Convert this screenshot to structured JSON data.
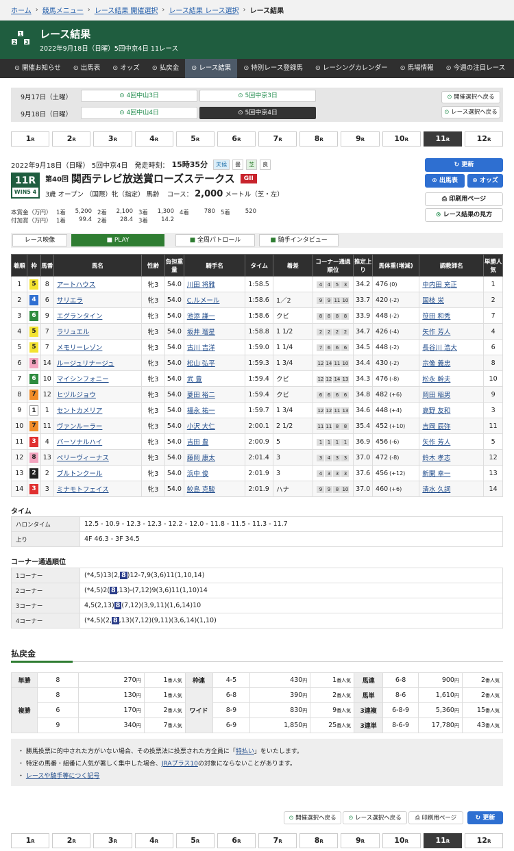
{
  "breadcrumb": {
    "home": "ホーム",
    "menu": "競馬メニュー",
    "kaisai": "レース結果 開催選択",
    "race": "レース結果 レース選択",
    "current": "レース結果"
  },
  "header": {
    "title": "レース結果",
    "subtitle": "2022年9月18日（日曜）5回中京4日 11レース",
    "logo": [
      "2",
      "1",
      "3"
    ]
  },
  "nav": [
    "開催お知らせ",
    "出馬表",
    "オッズ",
    "払戻金",
    "レース結果",
    "特別レース登録馬",
    "レーシングカレンダー",
    "馬場情報",
    "今週の注目レース"
  ],
  "dates": [
    {
      "label": "9月17日（土曜）",
      "m1": "4回中山3日",
      "m2": "5回中京3日"
    },
    {
      "label": "9月18日（日曜）",
      "m1": "4回中山4日",
      "m2": "5回中京4日"
    }
  ],
  "side_buttons": {
    "kaisai": "開催選択へ戻る",
    "race": "レース選択へ戻る"
  },
  "race_tabs": [
    "1",
    "2",
    "3",
    "4",
    "5",
    "6",
    "7",
    "8",
    "9",
    "10",
    "11",
    "12"
  ],
  "race_tab_suffix": "R",
  "cond": {
    "date": "2022年9月18日（日曜） 5回中京4日",
    "start_label": "発走時刻：",
    "start": "15時35分",
    "weather_k": "天候",
    "weather": "曇",
    "turf_k": "芝",
    "turf": "良"
  },
  "race": {
    "num": "11R",
    "win5": "WIN5 4",
    "ordinal": "第40回",
    "name": "関西テレビ放送賞ローズステークス",
    "grade": "GII",
    "conditions": "3歳 オープン （国際）牝（指定） 馬齢",
    "course_label": "コース：",
    "distance": "2,000",
    "course_tail": "メートル（芝・左）"
  },
  "right_buttons": {
    "update": "更新",
    "syutsuba": "出馬表",
    "odds": "オッズ",
    "print": "印刷用ページ",
    "guide": "レース結果の見方"
  },
  "prize": {
    "main_label": "本賞金（万円）",
    "main": [
      "1着",
      "5,200",
      "2着",
      "2,100",
      "3着",
      "1,300",
      "4着",
      "780",
      "5着",
      "520"
    ],
    "add_label": "付加賞（万円）",
    "add": [
      "1着",
      "99.4",
      "2着",
      "28.4",
      "3着",
      "14.2"
    ]
  },
  "video": {
    "label": "レース映像",
    "play": "PLAY",
    "patrol": "全周パトロール",
    "interview": "騎手インタビュー"
  },
  "table_headers": [
    "着順",
    "枠",
    "馬番",
    "馬名",
    "性齢",
    "負担重量",
    "騎手名",
    "タイム",
    "着差",
    "コーナー通過順位",
    "推定上り",
    "馬体重(増減)",
    "調教師名",
    "単勝人気"
  ],
  "results": [
    {
      "pos": "1",
      "waku": "5",
      "ban": "8",
      "name": "アートハウス",
      "sex": "牝3",
      "wt": "54.0",
      "jockey": "川田 将雅",
      "time": "1:58.5",
      "diff": "",
      "c": [
        "4",
        "4",
        "5",
        "3"
      ],
      "last": "34.2",
      "bw": "476",
      "bwd": "(0)",
      "trainer": "中内田 充正",
      "pop": "1"
    },
    {
      "pos": "2",
      "waku": "4",
      "ban": "6",
      "name": "サリエラ",
      "sex": "牝3",
      "wt": "54.0",
      "jockey": "C.ルメール",
      "time": "1:58.6",
      "diff": "1／2",
      "c": [
        "9",
        "9",
        "11",
        "10"
      ],
      "last": "33.7",
      "bw": "420",
      "bwd": "(-2)",
      "trainer": "国枝 栄",
      "pop": "2"
    },
    {
      "pos": "3",
      "waku": "6",
      "ban": "9",
      "name": "エグランタイン",
      "sex": "牝3",
      "wt": "54.0",
      "jockey": "池添 謙一",
      "time": "1:58.6",
      "diff": "クビ",
      "c": [
        "8",
        "8",
        "8",
        "8"
      ],
      "last": "33.9",
      "bw": "448",
      "bwd": "(-2)",
      "trainer": "笹田 和秀",
      "pop": "7"
    },
    {
      "pos": "4",
      "waku": "5",
      "ban": "7",
      "name": "ラリュエル",
      "sex": "牝3",
      "wt": "54.0",
      "jockey": "坂井 瑠星",
      "time": "1:58.8",
      "diff": "1 1/2",
      "c": [
        "2",
        "2",
        "2",
        "2"
      ],
      "last": "34.7",
      "bw": "426",
      "bwd": "(-4)",
      "trainer": "矢作 芳人",
      "pop": "4"
    },
    {
      "pos": "5",
      "waku": "5",
      "ban": "7",
      "name": "メモリーレゾン",
      "sex": "牝3",
      "wt": "54.0",
      "jockey": "古川 吉洋",
      "time": "1:59.0",
      "diff": "1 1/4",
      "c": [
        "7",
        "6",
        "6",
        "6"
      ],
      "last": "34.5",
      "bw": "448",
      "bwd": "(-2)",
      "trainer": "長谷川 浩大",
      "pop": "6"
    },
    {
      "pos": "6",
      "waku": "8",
      "ban": "14",
      "name": "ルージュリナージュ",
      "sex": "牝3",
      "wt": "54.0",
      "jockey": "松山 弘平",
      "time": "1:59.3",
      "diff": "1 3/4",
      "c": [
        "12",
        "14",
        "11",
        "10"
      ],
      "last": "34.4",
      "bw": "430",
      "bwd": "(-2)",
      "trainer": "宗像 義忠",
      "pop": "8"
    },
    {
      "pos": "7",
      "waku": "6",
      "ban": "10",
      "name": "マイシンフォニー",
      "sex": "牝3",
      "wt": "54.0",
      "jockey": "武 豊",
      "time": "1:59.4",
      "diff": "クビ",
      "c": [
        "12",
        "12",
        "14",
        "13"
      ],
      "last": "34.3",
      "bw": "476",
      "bwd": "(-8)",
      "trainer": "松永 幹夫",
      "pop": "10"
    },
    {
      "pos": "8",
      "waku": "7",
      "ban": "12",
      "name": "ヒヅルジョウ",
      "sex": "牝3",
      "wt": "54.0",
      "jockey": "菱田 裕二",
      "time": "1:59.4",
      "diff": "クビ",
      "c": [
        "6",
        "6",
        "6",
        "6"
      ],
      "last": "34.8",
      "bw": "482",
      "bwd": "(+6)",
      "trainer": "岡田 稲男",
      "pop": "9"
    },
    {
      "pos": "9",
      "waku": "1",
      "ban": "1",
      "name": "セントカメリア",
      "sex": "牝3",
      "wt": "54.0",
      "jockey": "福永 祐一",
      "time": "1:59.7",
      "diff": "1 3/4",
      "c": [
        "12",
        "12",
        "11",
        "13"
      ],
      "last": "34.6",
      "bw": "448",
      "bwd": "(+4)",
      "trainer": "高野 友和",
      "pop": "3"
    },
    {
      "pos": "10",
      "waku": "7",
      "ban": "11",
      "name": "ヴァンルーラー",
      "sex": "牝3",
      "wt": "54.0",
      "jockey": "小沢 大仁",
      "time": "2:00.1",
      "diff": "2 1/2",
      "c": [
        "11",
        "11",
        "8",
        "8"
      ],
      "last": "35.4",
      "bw": "452",
      "bwd": "(+10)",
      "trainer": "吉岡 辰弥",
      "pop": "11"
    },
    {
      "pos": "11",
      "waku": "3",
      "ban": "4",
      "name": "パーソナルハイ",
      "sex": "牝3",
      "wt": "54.0",
      "jockey": "吉田 豊",
      "time": "2:00.9",
      "diff": "5",
      "c": [
        "1",
        "1",
        "1",
        "1"
      ],
      "last": "36.9",
      "bw": "456",
      "bwd": "(-6)",
      "trainer": "矢作 芳人",
      "pop": "5"
    },
    {
      "pos": "12",
      "waku": "8",
      "ban": "13",
      "name": "ベリーヴィーナス",
      "sex": "牝3",
      "wt": "54.0",
      "jockey": "藤岡 康太",
      "time": "2:01.4",
      "diff": "3",
      "c": [
        "3",
        "4",
        "3",
        "3"
      ],
      "last": "37.0",
      "bw": "472",
      "bwd": "(-8)",
      "trainer": "鈴木 孝志",
      "pop": "12"
    },
    {
      "pos": "13",
      "waku": "2",
      "ban": "2",
      "name": "ブルトンクール",
      "sex": "牝3",
      "wt": "54.0",
      "jockey": "浜中 俊",
      "time": "2:01.9",
      "diff": "3",
      "c": [
        "4",
        "3",
        "3",
        "3"
      ],
      "last": "37.6",
      "bw": "456",
      "bwd": "(+12)",
      "trainer": "新開 幸一",
      "pop": "13"
    },
    {
      "pos": "14",
      "waku": "3",
      "ban": "3",
      "name": "ミナモトフェイス",
      "sex": "牝3",
      "wt": "54.0",
      "jockey": "鮫島 克駿",
      "time": "2:01.9",
      "diff": "ハナ",
      "c": [
        "9",
        "9",
        "8",
        "10"
      ],
      "last": "37.0",
      "bw": "460",
      "bwd": "(+6)",
      "trainer": "清水 久詞",
      "pop": "14"
    }
  ],
  "waku_colors": {
    "1": [
      "#ffffff",
      "#222222"
    ],
    "2": [
      "#222222",
      "#ffffff"
    ],
    "3": [
      "#e03030",
      "#ffffff"
    ],
    "4": [
      "#2f6fd1",
      "#ffffff"
    ],
    "5": [
      "#f3e330",
      "#222222"
    ],
    "6": [
      "#2e8b3e",
      "#ffffff"
    ],
    "7": [
      "#f08c28",
      "#222222"
    ],
    "8": [
      "#f3a4bf",
      "#222222"
    ]
  },
  "time_section": {
    "title": "タイム",
    "halon_label": "ハロンタイム",
    "halon": "12.5 - 10.9 - 12.3 - 12.3 - 12.2 - 12.0 - 11.8 - 11.5 - 11.3 - 11.7",
    "agari_label": "上り",
    "agari": "4F 46.3 - 3F 34.5"
  },
  "corner_section": {
    "title": "コーナー通過順位",
    "rows": [
      {
        "label": "1コーナー",
        "pre": "(*4,5)13(2,",
        "hl": "8",
        "post": ")12-7,9(3,6)11(1,10,14)"
      },
      {
        "label": "2コーナー",
        "pre": "(*4,5)2(",
        "hl": "8",
        "post": ",13)-(7,12)9(3,6)11(1,10)14"
      },
      {
        "label": "3コーナー",
        "pre": "4,5(2,13)",
        "hl": "8",
        "post": "(7,12)(3,9,11)(1,6,14)10"
      },
      {
        "label": "4コーナー",
        "pre": "(*4,5)(2,",
        "hl": "8",
        "post": ",13)(7,12)(9,11)(3,6,14)(1,10)"
      }
    ]
  },
  "payout": {
    "title": "払戻金",
    "yen": "円",
    "pop": "番人気",
    "tansho": {
      "k": "単勝",
      "ban": "8",
      "amt": "270",
      "pop": "1"
    },
    "fukusho": {
      "k": "複勝",
      "rows": [
        {
          "ban": "8",
          "amt": "130",
          "pop": "1"
        },
        {
          "ban": "6",
          "amt": "170",
          "pop": "2"
        },
        {
          "ban": "9",
          "amt": "340",
          "pop": "7"
        }
      ]
    },
    "wakuren": {
      "k": "枠連",
      "ban": "4-5",
      "amt": "430",
      "pop": "1"
    },
    "wide": {
      "k": "ワイド",
      "rows": [
        {
          "ban": "6-8",
          "amt": "390",
          "pop": "2"
        },
        {
          "ban": "8-9",
          "amt": "830",
          "pop": "9"
        },
        {
          "ban": "6-9",
          "amt": "1,850",
          "pop": "25"
        }
      ]
    },
    "umaren": {
      "k": "馬連",
      "ban": "6-8",
      "amt": "900",
      "pop": "2"
    },
    "umatan": {
      "k": "馬単",
      "ban": "8-6",
      "amt": "1,610",
      "pop": "2"
    },
    "sanrenpuku": {
      "k": "3連複",
      "ban": "6-8-9",
      "amt": "5,360",
      "pop": "15"
    },
    "sanrentan": {
      "k": "3連単",
      "ban": "8-6-9",
      "amt": "17,780",
      "pop": "43"
    }
  },
  "notes": {
    "n1a": "勝馬投票に的中された方がいない場合、その投票法に投票された方全員に「",
    "n1link": "特払い",
    "n1b": "」をいたします。",
    "n2a": "特定の馬番・組番に人気が著しく集中した場合、",
    "n2link": "JRAプラス10",
    "n2b": "の対象にならないことがあります。",
    "n3link": "レースや騎手等につく記号"
  }
}
